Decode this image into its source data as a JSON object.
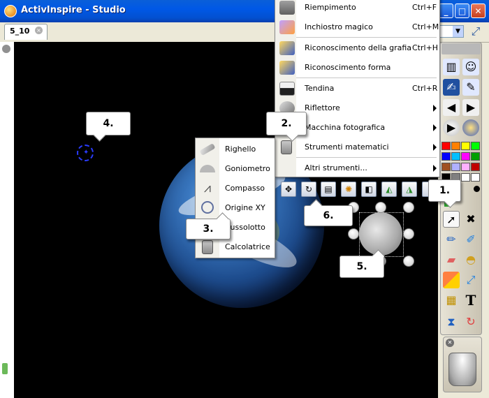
{
  "window": {
    "title": "ActivInspire - Studio",
    "minimize": "_",
    "maximize": "□",
    "close": "✕"
  },
  "tabs": [
    {
      "label": "5_10",
      "close": "×"
    }
  ],
  "main_menu": {
    "items": [
      {
        "label": "Riempimento",
        "shortcut": "Ctrl+F",
        "icon": "fill-bucket-icon"
      },
      {
        "label": "Inchiostro magico",
        "shortcut": "Ctrl+M",
        "icon": "magic-ink-icon"
      },
      {
        "label": "Riconoscimento della grafia",
        "shortcut": "Ctrl+H",
        "icon": "handwriting-recognition-icon"
      },
      {
        "label": "Riconoscimento forma",
        "shortcut": "",
        "icon": "shape-recognition-icon"
      },
      {
        "label": "Tendina",
        "shortcut": "Ctrl+R",
        "icon": "revealer-icon"
      },
      {
        "label": "Riflettore",
        "shortcut": "",
        "icon": "spotlight-icon",
        "submenu": true
      },
      {
        "label": "Macchina fotografica",
        "shortcut": "",
        "icon": "camera-icon",
        "submenu": true
      },
      {
        "label": "Strumenti matematici",
        "shortcut": "",
        "icon": "calculator-icon",
        "submenu": true
      },
      {
        "label": "Altri strumenti...",
        "shortcut": "",
        "icon": "",
        "submenu": true
      }
    ]
  },
  "math_submenu": {
    "items": [
      {
        "label": "Righello",
        "icon": "ruler-icon"
      },
      {
        "label": "Goniometro",
        "icon": "protractor-icon"
      },
      {
        "label": "Compasso",
        "icon": "compass-icon"
      },
      {
        "label": "Origine XY",
        "icon": "xy-origin-icon"
      },
      {
        "label": "Bussolotto",
        "icon": "dice-icon"
      },
      {
        "label": "Calcolatrice",
        "icon": "calculator-icon"
      }
    ]
  },
  "callouts": [
    "1.",
    "2.",
    "3.",
    "4.",
    "5.",
    "6."
  ],
  "palette_colors": [
    "#ff0000",
    "#ff8000",
    "#ffff00",
    "#00ff00",
    "#0000ff",
    "#00c0ff",
    "#ff00ff",
    "#00a000",
    "#a05020",
    "#b0b0ff",
    "#ffb0ff",
    "#c00000",
    "#000000",
    "#808080",
    "#ffffff",
    "#ffffff"
  ],
  "colors": {
    "titlebar": "#0058e6",
    "canvas": "#000000",
    "menu_background": "#ffffff"
  }
}
